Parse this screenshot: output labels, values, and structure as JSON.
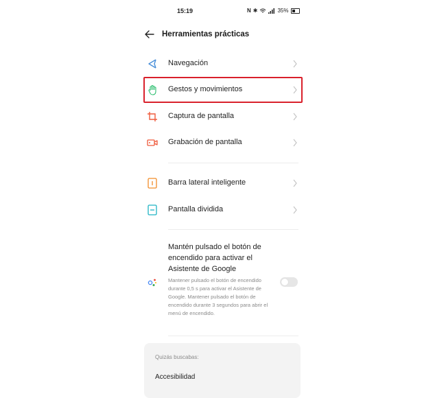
{
  "status_bar": {
    "time": "15:19",
    "battery_text": "35%",
    "icons": [
      "nfc-icon",
      "bluetooth-icon",
      "wifi-icon",
      "signal-icon",
      "battery-icon"
    ]
  },
  "header": {
    "title": "Herramientas prácticas",
    "back_icon": "arrow-left-icon"
  },
  "group1": [
    {
      "label": "Navegación",
      "icon": "navigation-arrow-icon",
      "icon_color": "#4a90d9"
    },
    {
      "label": "Gestos y movimientos",
      "icon": "hand-icon",
      "icon_color": "#2fbf71"
    },
    {
      "label": "Captura de pantalla",
      "icon": "crop-icon",
      "icon_color": "#ef5a3c"
    },
    {
      "label": "Grabación de pantalla",
      "icon": "video-icon",
      "icon_color": "#ef5a3c"
    }
  ],
  "group2": [
    {
      "label": "Barra lateral inteligente",
      "icon": "sidebar-icon",
      "icon_color": "#f28c28"
    },
    {
      "label": "Pantalla dividida",
      "icon": "split-screen-icon",
      "icon_color": "#1eb3c4"
    }
  ],
  "assistant": {
    "title": "Mantén pulsado el botón de encendido para activar el Asistente de Google",
    "description": "Mantener pulsado el botón de encendido durante 0,5 s para activar el Asistente de Google. Mantener pulsado el botón de encendido durante 3 segundos para abrir el menú de encendido.",
    "icon": "google-assistant-icon",
    "toggle_on": false
  },
  "suggestions": {
    "heading": "Quizás buscabas:",
    "items": [
      "Accesibilidad"
    ]
  },
  "highlight_color": "#d9202b"
}
